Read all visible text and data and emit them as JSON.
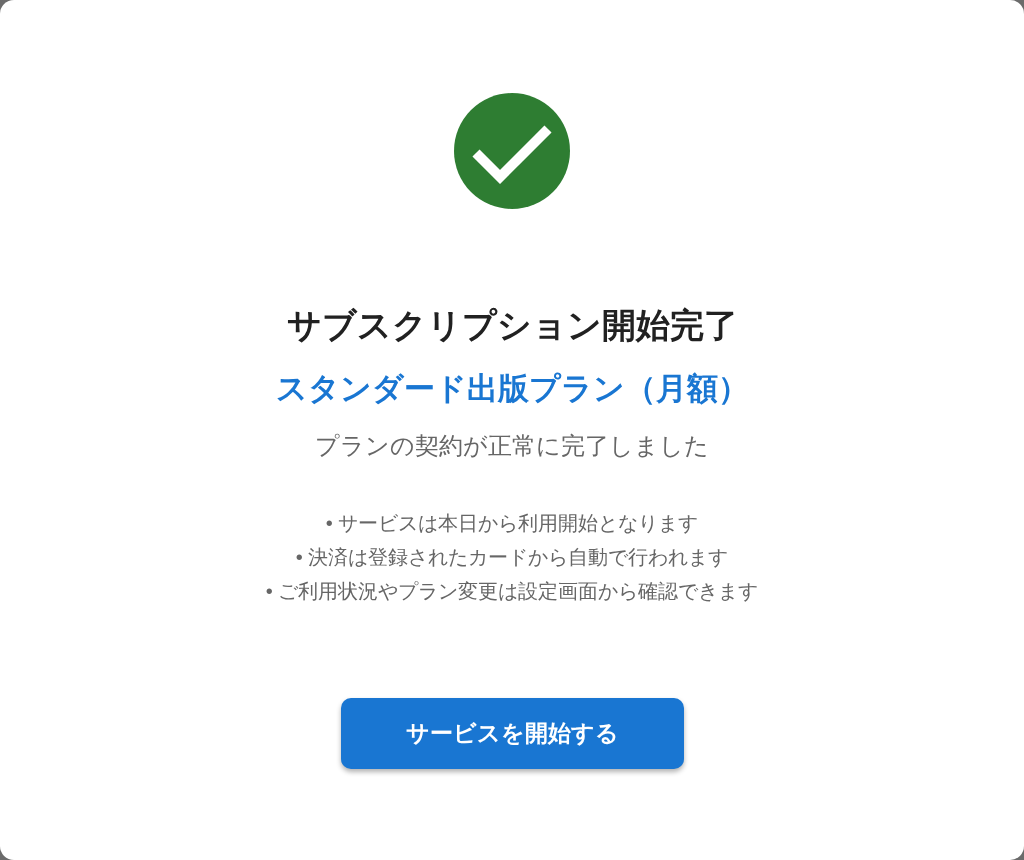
{
  "dialog": {
    "title": "サブスクリプション開始完了",
    "plan": "スタンダード出版プラン（月額）",
    "message": "プランの契約が正常に完了しました",
    "notes": [
      "• サービスは本日から利用開始となります",
      "• 決済は登録されたカードから自動で行われます",
      "• ご利用状況やプラン変更は設定画面から確認できます"
    ],
    "button": "サービスを開始する"
  }
}
